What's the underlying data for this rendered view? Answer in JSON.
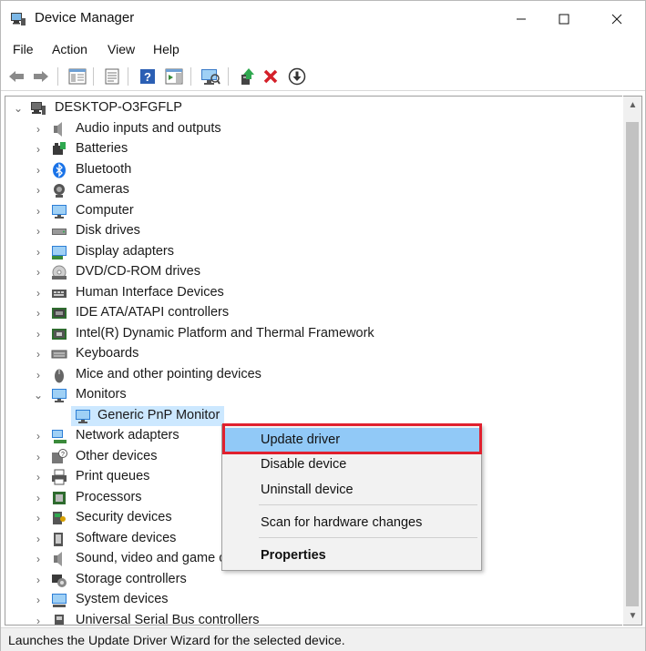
{
  "window": {
    "title": "Device Manager",
    "icon": "device-manager-icon",
    "controls": [
      "minimize-icon",
      "maximize-icon",
      "close-icon"
    ]
  },
  "menu": [
    "File",
    "Action",
    "View",
    "Help"
  ],
  "toolbar": [
    "back-icon",
    "forward-icon",
    "show-hide-tree-icon",
    "properties-icon",
    "help-icon",
    "action-pane-icon",
    "scan-hardware-icon",
    "update-driver-icon",
    "uninstall-icon",
    "download-icon"
  ],
  "tree": {
    "root": "DESKTOP-O3FGFLP",
    "categories": [
      {
        "label": "Audio inputs and outputs",
        "icon": "speaker-icon",
        "expanded": false
      },
      {
        "label": "Batteries",
        "icon": "battery-icon",
        "expanded": false
      },
      {
        "label": "Bluetooth",
        "icon": "bluetooth-icon",
        "expanded": false
      },
      {
        "label": "Cameras",
        "icon": "camera-icon",
        "expanded": false
      },
      {
        "label": "Computer",
        "icon": "computer-icon",
        "expanded": false
      },
      {
        "label": "Disk drives",
        "icon": "disk-icon",
        "expanded": false
      },
      {
        "label": "Display adapters",
        "icon": "display-adapter-icon",
        "expanded": false
      },
      {
        "label": "DVD/CD-ROM drives",
        "icon": "dvd-icon",
        "expanded": false
      },
      {
        "label": "Human Interface Devices",
        "icon": "hid-icon",
        "expanded": false
      },
      {
        "label": "IDE ATA/ATAPI controllers",
        "icon": "ide-icon",
        "expanded": false
      },
      {
        "label": "Intel(R) Dynamic Platform and Thermal Framework",
        "icon": "chip-icon",
        "expanded": false
      },
      {
        "label": "Keyboards",
        "icon": "keyboard-icon",
        "expanded": false
      },
      {
        "label": "Mice and other pointing devices",
        "icon": "mouse-icon",
        "expanded": false
      },
      {
        "label": "Monitors",
        "icon": "monitor-icon",
        "expanded": true
      },
      {
        "label": "Network adapters",
        "icon": "network-icon",
        "expanded": false
      },
      {
        "label": "Other devices",
        "icon": "unknown-device-icon",
        "expanded": false
      },
      {
        "label": "Print queues",
        "icon": "printer-icon",
        "expanded": false
      },
      {
        "label": "Processors",
        "icon": "processor-icon",
        "expanded": false
      },
      {
        "label": "Security devices",
        "icon": "security-icon",
        "expanded": false
      },
      {
        "label": "Software devices",
        "icon": "software-icon",
        "expanded": false
      },
      {
        "label": "Sound, video and game c",
        "icon": "sound-icon",
        "expanded": false
      },
      {
        "label": "Storage controllers",
        "icon": "storage-icon",
        "expanded": false
      },
      {
        "label": "System devices",
        "icon": "system-icon",
        "expanded": false
      },
      {
        "label": "Universal Serial Bus controllers",
        "icon": "usb-icon",
        "expanded": false
      }
    ],
    "monitor_child": "Generic PnP Monitor"
  },
  "context_menu": {
    "items": [
      "Update driver",
      "Disable device",
      "Uninstall device",
      "Scan for hardware changes",
      "Properties"
    ],
    "highlighted": "Update driver",
    "highlight_color": "#e0202e"
  },
  "status": "Launches the Update Driver Wizard for the selected device."
}
